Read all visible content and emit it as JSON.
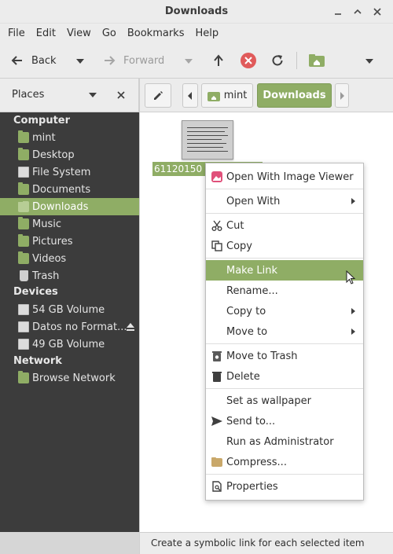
{
  "window": {
    "title": "Downloads"
  },
  "menubar": [
    "File",
    "Edit",
    "View",
    "Go",
    "Bookmarks",
    "Help"
  ],
  "toolbar": {
    "back": "Back",
    "forward": "Forward"
  },
  "sidebar": {
    "header": "Places",
    "sections": [
      {
        "title": "Computer",
        "items": [
          {
            "label": "mint",
            "icon": "home-folder-icon"
          },
          {
            "label": "Desktop",
            "icon": "desktop-folder-icon"
          },
          {
            "label": "File System",
            "icon": "drive-icon"
          },
          {
            "label": "Documents",
            "icon": "folder-icon"
          },
          {
            "label": "Downloads",
            "icon": "download-folder-icon",
            "selected": true
          },
          {
            "label": "Music",
            "icon": "music-folder-icon"
          },
          {
            "label": "Pictures",
            "icon": "pictures-folder-icon"
          },
          {
            "label": "Videos",
            "icon": "videos-folder-icon"
          },
          {
            "label": "Trash",
            "icon": "trash-icon"
          }
        ]
      },
      {
        "title": "Devices",
        "items": [
          {
            "label": "54 GB Volume",
            "icon": "drive-icon"
          },
          {
            "label": "Datos no Format...",
            "icon": "drive-icon",
            "eject": true
          },
          {
            "label": "49 GB Volume",
            "icon": "drive-icon"
          }
        ]
      },
      {
        "title": "Network",
        "items": [
          {
            "label": "Browse Network",
            "icon": "network-folder-icon"
          }
        ]
      }
    ]
  },
  "pathbar": {
    "crumbs": [
      "mint",
      "Downloads"
    ]
  },
  "file": {
    "name": "61120150"
  },
  "context_menu": [
    {
      "label": "Open With Image Viewer",
      "icon": "image-viewer-icon"
    },
    {
      "sep": true
    },
    {
      "label": "Open With",
      "submenu": true
    },
    {
      "sep": true
    },
    {
      "label": "Cut",
      "icon": "scissors-icon"
    },
    {
      "label": "Copy",
      "icon": "copy-icon"
    },
    {
      "sep": true
    },
    {
      "label": "Make Link",
      "highlighted": true
    },
    {
      "label": "Rename..."
    },
    {
      "label": "Copy to",
      "submenu": true
    },
    {
      "label": "Move to",
      "submenu": true
    },
    {
      "sep": true
    },
    {
      "label": "Move to Trash",
      "icon": "trash-icon"
    },
    {
      "label": "Delete",
      "icon": "delete-icon"
    },
    {
      "sep": true
    },
    {
      "label": "Set as wallpaper"
    },
    {
      "label": "Send to...",
      "icon": "send-icon"
    },
    {
      "label": "Run as Administrator"
    },
    {
      "label": "Compress...",
      "icon": "archive-icon"
    },
    {
      "sep": true
    },
    {
      "label": "Properties",
      "icon": "properties-icon"
    }
  ],
  "statusbar": {
    "text": "Create a symbolic link for each selected item"
  },
  "colors": {
    "accent": "#8fad65",
    "sidebar_bg": "#3c3c3c",
    "stop": "#e05a5a"
  }
}
